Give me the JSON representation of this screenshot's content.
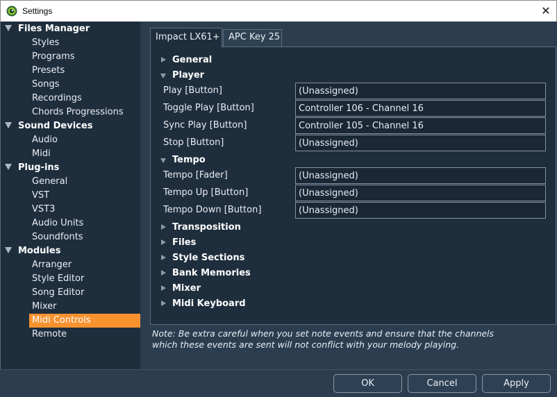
{
  "window": {
    "title": "Settings",
    "close_glyph": "✕",
    "app_icon": "app-logo-icon",
    "close_icon": "close-icon"
  },
  "colors": {
    "sidebar_bg": "#1f2e3d",
    "main_bg": "#2b3d4f",
    "selected": "#f7922f",
    "border": "#5c6e80"
  },
  "sidebar": {
    "categories": [
      {
        "label": "Files Manager",
        "items": [
          "Styles",
          "Programs",
          "Presets",
          "Songs",
          "Recordings",
          "Chords Progressions"
        ]
      },
      {
        "label": "Sound Devices",
        "items": [
          "Audio",
          "Midi"
        ]
      },
      {
        "label": "Plug-ins",
        "items": [
          "General",
          "VST",
          "VST3",
          "Audio Units",
          "Soundfonts"
        ]
      },
      {
        "label": "Modules",
        "items": [
          "Arranger",
          "Style Editor",
          "Song Editor",
          "Mixer",
          "Midi Controls",
          "Remote"
        ]
      }
    ],
    "selected": "Midi Controls"
  },
  "tabs": [
    {
      "label": "Impact LX61+",
      "active": true
    },
    {
      "label": "APC Key 25",
      "active": false
    }
  ],
  "sections": {
    "general": "General",
    "player": {
      "label": "Player",
      "rows": [
        {
          "label": "Play [Button]",
          "value": "(Unassigned)"
        },
        {
          "label": "Toggle Play [Button]",
          "value": "Controller 106 - Channel 16"
        },
        {
          "label": "Sync Play [Button]",
          "value": "Controller 105 - Channel 16"
        },
        {
          "label": "Stop [Button]",
          "value": "(Unassigned)"
        }
      ]
    },
    "tempo": {
      "label": "Tempo",
      "rows": [
        {
          "label": "Tempo [Fader]",
          "value": "(Unassigned)"
        },
        {
          "label": "Tempo Up [Button]",
          "value": "(Unassigned)"
        },
        {
          "label": "Tempo Down [Button]",
          "value": "(Unassigned)"
        }
      ]
    },
    "collapsed": [
      "Transposition",
      "Files",
      "Style Sections",
      "Bank Memories",
      "Mixer",
      "Midi Keyboard"
    ]
  },
  "note": {
    "line1": "Note: Be extra careful when you set note events and ensure that the channels",
    "line2": "which these events are sent will not conflict with your melody playing."
  },
  "buttons": {
    "ok": "OK",
    "cancel": "Cancel",
    "apply": "Apply"
  }
}
